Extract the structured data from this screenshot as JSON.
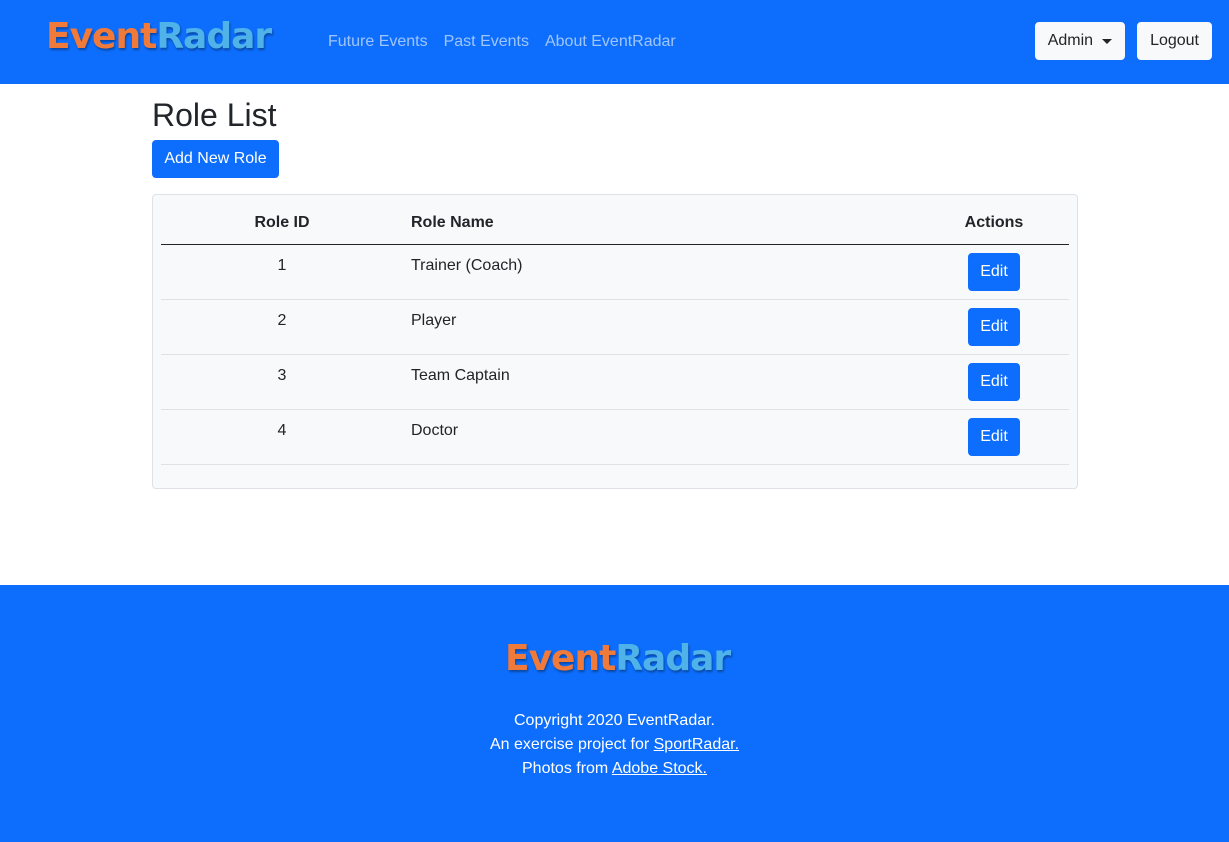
{
  "brand": {
    "part1": "Event",
    "part2": "Radar"
  },
  "nav": {
    "links": [
      "Future Events",
      "Past Events",
      "About EventRadar"
    ],
    "admin_label": "Admin",
    "logout_label": "Logout"
  },
  "page": {
    "title": "Role List",
    "add_button": "Add New Role"
  },
  "table": {
    "headers": [
      "Role ID",
      "Role Name",
      "Actions"
    ],
    "edit_label": "Edit",
    "rows": [
      {
        "id": "1",
        "name": "Trainer (Coach)"
      },
      {
        "id": "2",
        "name": "Player"
      },
      {
        "id": "3",
        "name": "Team Captain"
      },
      {
        "id": "4",
        "name": "Doctor"
      }
    ]
  },
  "footer": {
    "line1": "Copyright 2020 EventRadar.",
    "line2_prefix": "An exercise project for",
    "line2_link": "SportRadar.",
    "line3_prefix": "Photos from",
    "line3_link": "Adobe Stock."
  },
  "colors": {
    "primary": "#0d6efd",
    "logo_orange": "#f07a3a",
    "logo_blue": "#4fb3ea"
  }
}
